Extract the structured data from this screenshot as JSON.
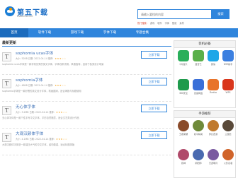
{
  "header": {
    "logo_text": "第五下载",
    "logo_sub": "www.d5xz.net",
    "search_placeholder": "请输入要找的内容",
    "search_button": "搜索",
    "hot_label": "热门搜索:",
    "hot_links": [
      "游戏",
      "软件",
      "字体",
      "壁纸",
      "素材"
    ]
  },
  "nav": [
    "首页",
    "软件下载",
    "游戏下载",
    "字体下载",
    "专题合集"
  ],
  "main": {
    "section_title": "最新更新",
    "download_label": "立即下载",
    "items": [
      {
        "title": "sophomia ucas字体",
        "meta": "大小: 52KB  日期: 2022-04-14  推荐:",
        "stars": "★★★☆☆",
        "desc": "sophomia ucas字体是一款非常优秀的英文字体，字体线条流畅，风格独特，适用于各类设计场景"
      },
      {
        "title": "sophomia字体",
        "meta": "大小: 48KB  日期: 2022-04-14  推荐:",
        "stars": "★★★☆☆",
        "desc": "sophomia字体是一款好看的英文设计字体，笔画圆润，适合海报与标题使用"
      },
      {
        "title": "无心体字体",
        "meta": "大小: 3.2MB  日期: 2022-04-14  推荐:",
        "stars": "★★★☆☆",
        "desc": "无心体字体是一款个性手写中文字体，字形自然随意，适合文艺类设计作品"
      },
      {
        "title": "大观汉颜体字体",
        "meta": "大小: 4.1MB  日期: 2022-04-14  推荐:",
        "stars": "★★★☆☆",
        "desc": "大观汉颜体字体是一款端庄大气的中文字体，结构稳重，适合标题排版"
      }
    ]
  },
  "sidebar": {
    "apps_title": "装机必备",
    "apps": [
      {
        "name": "QQ音乐",
        "icon": "music-app-icon",
        "color": "#2aaf5b"
      },
      {
        "name": "爱奇艺",
        "icon": "video-app-icon",
        "color": "#5ab04a"
      },
      {
        "name": "微信",
        "icon": "chat-app-icon",
        "color": "#1fa7e8"
      },
      {
        "name": "WiFi助手",
        "icon": "wifi-app-icon",
        "color": "#3b7fe0"
      },
      {
        "name": "360安全",
        "icon": "shield-app-icon",
        "color": "#1f9a4c"
      },
      {
        "name": "百度网盘",
        "icon": "cloud-app-icon",
        "color": "#3a6fd8"
      },
      {
        "name": "Firefox",
        "icon": "browser-app-icon",
        "color": "#e8742a"
      },
      {
        "name": "WPS",
        "icon": "office-app-icon",
        "color": "#d9361c"
      }
    ],
    "games_title": "手游推荐",
    "games": [
      {
        "name": "王者荣耀",
        "icon": "game-icon",
        "color": "#8a4b2a"
      },
      {
        "name": "和平精英",
        "icon": "game-icon",
        "color": "#6f8a3a"
      },
      {
        "name": "梦幻西游",
        "icon": "game-icon",
        "color": "#c07a2e"
      },
      {
        "name": "三国志",
        "icon": "game-icon",
        "color": "#5a4a3a"
      },
      {
        "name": "原神",
        "icon": "game-icon",
        "color": "#b04a6a"
      },
      {
        "name": "阴阳师",
        "icon": "game-icon",
        "color": "#4a6ab0"
      },
      {
        "name": "天涯明月",
        "icon": "game-icon",
        "color": "#7a5aa0"
      },
      {
        "name": "火影忍者",
        "icon": "game-icon",
        "color": "#d0642a"
      }
    ]
  }
}
